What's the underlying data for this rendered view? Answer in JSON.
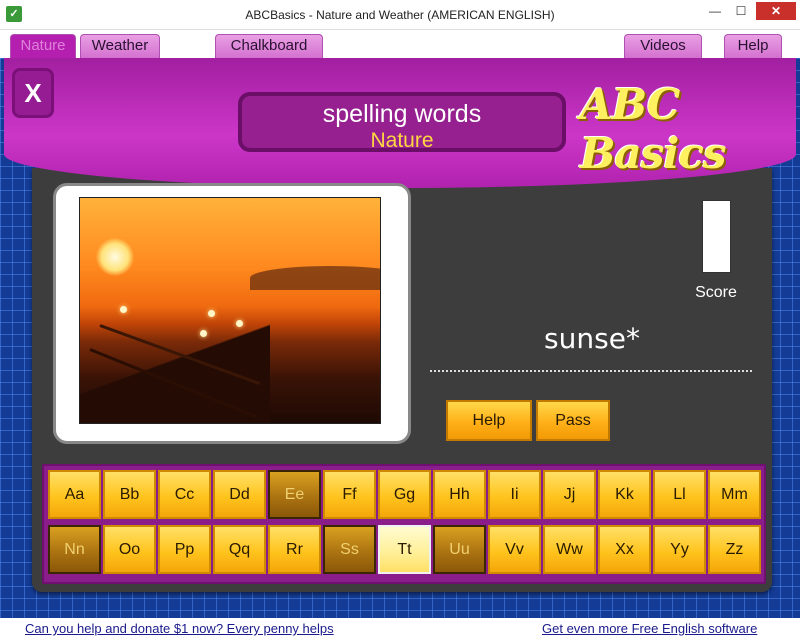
{
  "window": {
    "title": "ABCBasics - Nature and Weather (AMERICAN ENGLISH)",
    "minimize": "—",
    "maximize": "☐",
    "close": "✕"
  },
  "tabs": {
    "nature": "Nature",
    "weather": "Weather",
    "chalkboard": "Chalkboard",
    "videos": "Videos",
    "help": "Help",
    "active": "Nature"
  },
  "header": {
    "close_label": "X",
    "title_main": "spelling words",
    "title_sub": "Nature",
    "logo_text": "ABC Basics"
  },
  "game": {
    "score_label": "Score",
    "current_word": "sunse*",
    "help_button": "Help",
    "pass_button": "Pass"
  },
  "keyboard": {
    "row1": [
      "Aa",
      "Bb",
      "Cc",
      "Dd",
      "Ee",
      "Ff",
      "Gg",
      "Hh",
      "Ii",
      "Jj",
      "Kk",
      "Ll",
      "Mm"
    ],
    "row2": [
      "Nn",
      "Oo",
      "Pp",
      "Qq",
      "Rr",
      "Ss",
      "Tt",
      "Uu",
      "Vv",
      "Ww",
      "Xx",
      "Yy",
      "Zz"
    ],
    "used_keys": [
      "Ee",
      "Nn",
      "Ss",
      "Uu"
    ],
    "highlighted_key": "Tt"
  },
  "footer": {
    "donate_link": "Can you help and donate $1 now? Every penny helps",
    "more_link": "Get even more Free English software"
  },
  "colors": {
    "header_magenta": "#b41fb0",
    "title_yellow": "#ffd740",
    "key_orange": "#ffc41e",
    "background_blue": "#143c96"
  }
}
